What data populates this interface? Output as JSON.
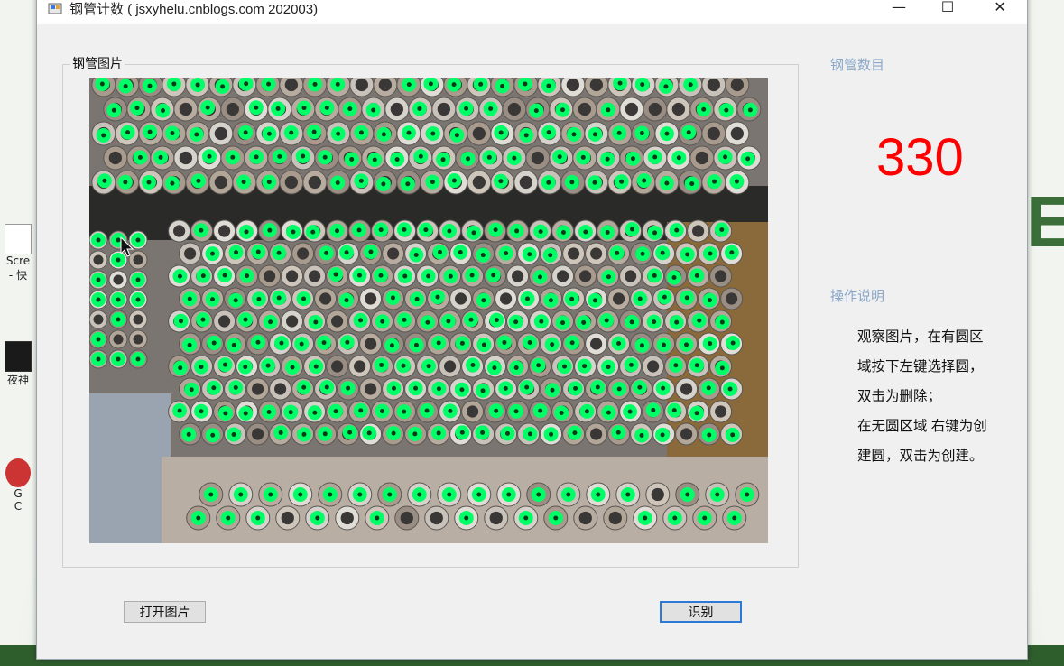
{
  "window": {
    "title": "钢管计数 ( jsxyhelu.cnblogs.com 202003)",
    "controls": {
      "minimize": "—",
      "maximize": "☐",
      "close": "✕"
    }
  },
  "photo_group": {
    "label": "钢管图片"
  },
  "count_panel": {
    "label": "钢管数目",
    "value": "330"
  },
  "help": {
    "label": "操作说明",
    "lines": [
      "观察图片，在有圆区",
      "域按下左键选择圆，",
      "双击为删除；",
      "在无圆区域 右键为创",
      "建圆，双击为创建。"
    ]
  },
  "buttons": {
    "open": "打开图片",
    "recognize": "识别"
  },
  "desktop": {
    "icons": [
      "Scre",
      "- 快",
      "夜神",
      "G",
      "C"
    ],
    "right_text": "E"
  },
  "colors": {
    "accent": "#2d7ad6",
    "count": "#ff0000",
    "marker": "#00ff66",
    "label": "#8aa7c7"
  }
}
